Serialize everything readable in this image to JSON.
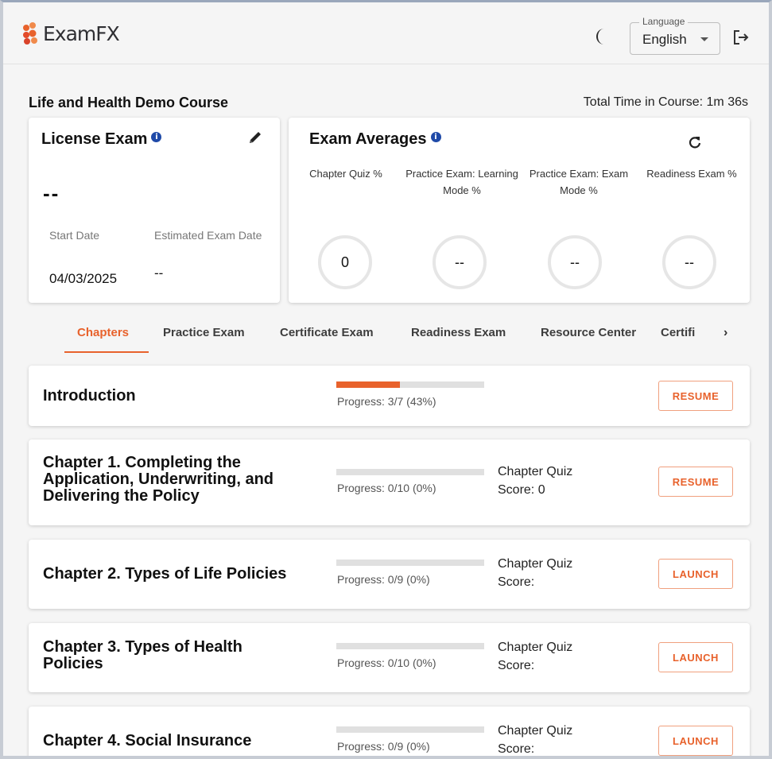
{
  "header": {
    "logo_text": "ExamFX",
    "language_legend": "Language",
    "language_value": "English"
  },
  "course": {
    "title": "Life and Health Demo Course",
    "total_time": "Total Time in Course: 1m 36s"
  },
  "license_card": {
    "title": "License Exam",
    "value": "--",
    "start_date_label": "Start Date",
    "start_date_value": "04/03/2025",
    "estimated_label": "Estimated Exam Date",
    "estimated_value": "--"
  },
  "averages_card": {
    "title": "Exam Averages",
    "columns": [
      {
        "label": "Chapter Quiz %",
        "value": "0"
      },
      {
        "label": "Practice Exam: Learning Mode %",
        "value": "--"
      },
      {
        "label": "Practice Exam: Exam Mode %",
        "value": "--"
      },
      {
        "label": "Readiness Exam %",
        "value": "--"
      }
    ]
  },
  "tabs": {
    "items": [
      "Chapters",
      "Practice Exam",
      "Certificate Exam",
      "Readiness Exam",
      "Resource Center",
      "Certifi"
    ],
    "active": 0
  },
  "chapters": [
    {
      "title": "Introduction",
      "progress_text": "Progress: 3/7 (43%)",
      "progress": 0.43,
      "quiz_line1": "",
      "quiz_line2": "",
      "button": "RESUME"
    },
    {
      "title": "Chapter 1. Completing the Application, Underwriting, and Delivering the Policy",
      "progress_text": "Progress: 0/10 (0%)",
      "progress": 0,
      "quiz_line1": "Chapter Quiz",
      "quiz_line2": "Score: 0",
      "button": "RESUME"
    },
    {
      "title": "Chapter 2. Types of Life Policies",
      "progress_text": "Progress: 0/9 (0%)",
      "progress": 0,
      "quiz_line1": "Chapter Quiz",
      "quiz_line2": "Score:",
      "button": "LAUNCH"
    },
    {
      "title": "Chapter 3. Types of Health Policies",
      "progress_text": "Progress: 0/10 (0%)",
      "progress": 0,
      "quiz_line1": "Chapter Quiz",
      "quiz_line2": "Score:",
      "button": "LAUNCH"
    },
    {
      "title": "Chapter 4. Social Insurance",
      "progress_text": "Progress: 0/9 (0%)",
      "progress": 0,
      "quiz_line1": "Chapter Quiz",
      "quiz_line2": "Score:",
      "button": "LAUNCH"
    }
  ],
  "colors": {
    "accent": "#e8622c",
    "info": "#1f4aa8"
  }
}
